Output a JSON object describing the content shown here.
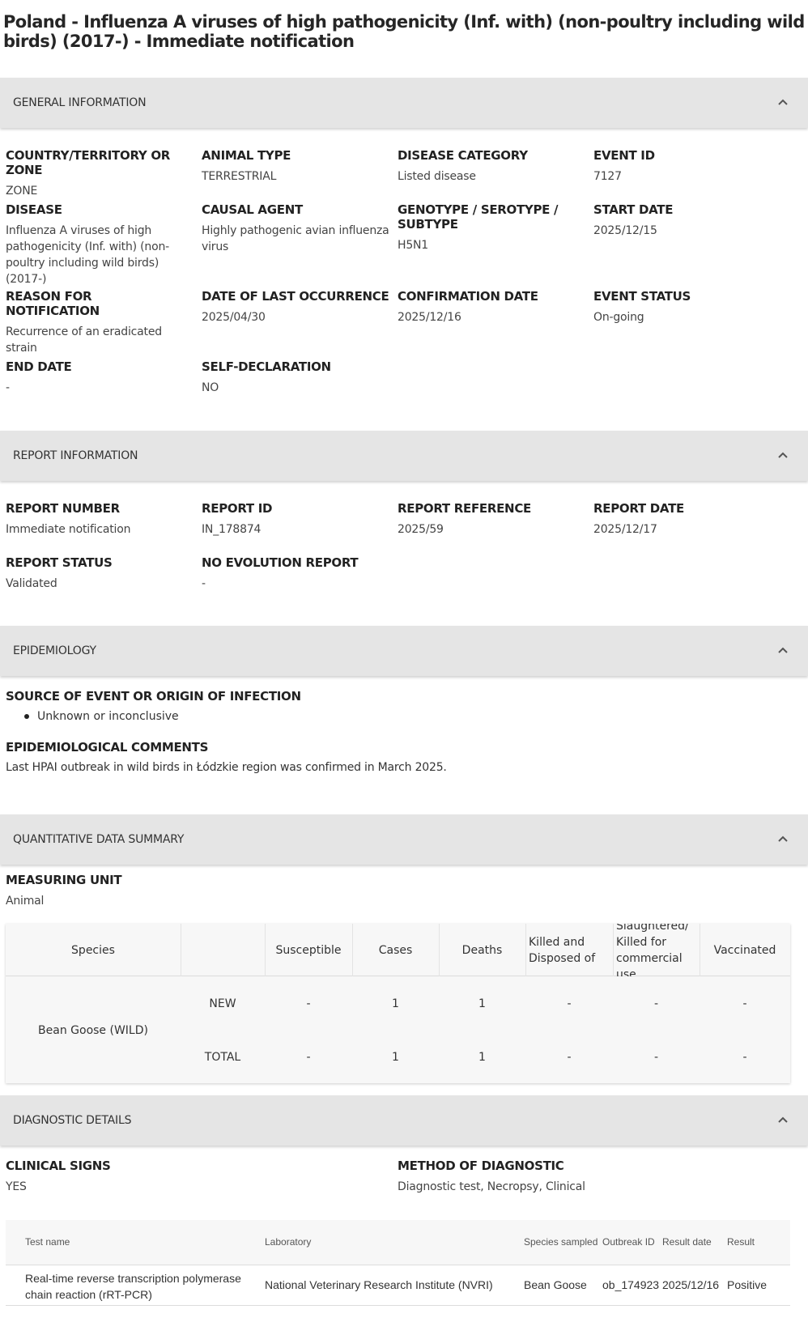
{
  "title": "Poland - Influenza A viruses of high pathogenicity (Inf. with) (non-poultry including wild birds) (2017-) - Immediate notification",
  "icons": {
    "collapse": "chevron-up-icon"
  },
  "general": {
    "header": "GENERAL INFORMATION",
    "fields": [
      {
        "label": "COUNTRY/TERRITORY OR ZONE",
        "value": "ZONE"
      },
      {
        "label": "ANIMAL TYPE",
        "value": "TERRESTRIAL"
      },
      {
        "label": "DISEASE CATEGORY",
        "value": "Listed disease"
      },
      {
        "label": "EVENT ID",
        "value": "7127"
      },
      {
        "label": "DISEASE",
        "value": "Influenza A viruses of high pathogenicity (Inf. with) (non-poultry including wild birds) (2017-)"
      },
      {
        "label": "CAUSAL AGENT",
        "value": "Highly pathogenic avian influenza virus"
      },
      {
        "label": "GENOTYPE / SEROTYPE / SUBTYPE",
        "value": "H5N1"
      },
      {
        "label": "START DATE",
        "value": "2025/12/15"
      },
      {
        "label": "REASON FOR NOTIFICATION",
        "value": "Recurrence of an eradicated strain"
      },
      {
        "label": "DATE OF LAST OCCURRENCE",
        "value": "2025/04/30"
      },
      {
        "label": "CONFIRMATION DATE",
        "value": "2025/12/16"
      },
      {
        "label": "EVENT STATUS",
        "value": "On-going"
      },
      {
        "label": "END DATE",
        "value": "-"
      },
      {
        "label": "SELF-DECLARATION",
        "value": "NO"
      }
    ]
  },
  "report": {
    "header": "REPORT INFORMATION",
    "fields": [
      {
        "label": "REPORT NUMBER",
        "value": "Immediate notification"
      },
      {
        "label": "REPORT ID",
        "value": "IN_178874"
      },
      {
        "label": "REPORT REFERENCE",
        "value": "2025/59"
      },
      {
        "label": "REPORT DATE",
        "value": "2025/12/17"
      },
      {
        "label": "REPORT STATUS",
        "value": "Validated"
      },
      {
        "label": "NO EVOLUTION REPORT",
        "value": "-"
      }
    ]
  },
  "epidemiology": {
    "header": "EPIDEMIOLOGY",
    "source_label": "SOURCE OF EVENT OR ORIGIN OF INFECTION",
    "sources": [
      "Unknown or inconclusive"
    ],
    "comments_label": "EPIDEMIOLOGICAL COMMENTS",
    "comments": "Last HPAI outbreak in wild birds in Łódzkie region was confirmed in March 2025."
  },
  "quantitative": {
    "header": "QUANTITATIVE DATA SUMMARY",
    "unit_label": "MEASURING UNIT",
    "unit_value": "Animal",
    "columns": [
      "Species",
      "Susceptible",
      "Cases",
      "Deaths",
      "Killed and Disposed of",
      "Slaughtered/ Killed for commercial use",
      "Vaccinated"
    ],
    "species": "Bean Goose (WILD)",
    "rows": [
      {
        "label": "NEW",
        "values": [
          "-",
          "1",
          "1",
          "-",
          "-",
          "-"
        ]
      },
      {
        "label": "TOTAL",
        "values": [
          "-",
          "1",
          "1",
          "-",
          "-",
          "-"
        ]
      }
    ]
  },
  "diagnostic": {
    "header": "DIAGNOSTIC DETAILS",
    "clinical_label": "CLINICAL SIGNS",
    "clinical_value": "YES",
    "method_label": "METHOD OF DIAGNOSTIC",
    "method_value": "Diagnostic test, Necropsy, Clinical",
    "columns": [
      "Test name",
      "Laboratory",
      "Species sampled",
      "Outbreak ID",
      "Result date",
      "Result"
    ],
    "rows": [
      {
        "test": "Real-time reverse transcription polymerase chain reaction (rRT-PCR)",
        "lab": "National Veterinary Research Institute (NVRI)",
        "species": "Bean Goose",
        "outbreak": "ob_174923",
        "date": "2025/12/16",
        "result": "Positive"
      }
    ]
  }
}
